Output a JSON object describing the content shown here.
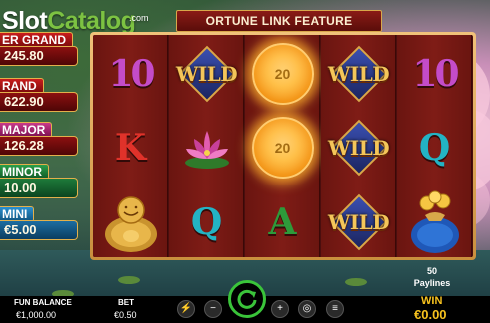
{
  "logo": {
    "slot": "Slot",
    "catalog": "Catalog",
    "com": ".com"
  },
  "banner": {
    "text": "ORTUNE LINK FEATURE"
  },
  "jackpots": [
    {
      "title": "ER GRAND",
      "value": "245.80"
    },
    {
      "title": "RAND",
      "value": "622.90"
    },
    {
      "title": "MAJOR",
      "value": "126.28"
    },
    {
      "title": "MINOR",
      "value": "10.00"
    },
    {
      "title": "MINI",
      "value": "€5.00"
    }
  ],
  "reels": {
    "col1": [
      "10",
      "K",
      "buddha"
    ],
    "col2": [
      "WILD",
      "lotus",
      "Q"
    ],
    "col3": [
      "20",
      "20",
      "A"
    ],
    "col4": [
      "WILD",
      "WILD",
      "WILD"
    ],
    "col5": [
      "10",
      "Q",
      "moneybag"
    ]
  },
  "coin_values": [
    "20",
    "20"
  ],
  "wild_label": "WILD",
  "paylines": {
    "count": "50",
    "label": "Paylines"
  },
  "balance": {
    "label": "FUN BALANCE",
    "value": "€1,000.00"
  },
  "bet": {
    "label": "BET",
    "value": "€0.50"
  },
  "win": {
    "label": "WIN",
    "value": "€0.00"
  },
  "controls": {
    "lightning_icon": "lightning-icon",
    "minus_icon": "minus-icon",
    "spin_icon": "refresh-icon",
    "plus_icon": "plus-icon",
    "coins_icon": "coin-stack-icon",
    "menu_icon": "menu-icon",
    "minus_symbol": "−",
    "plus_symbol": "+",
    "lightning_symbol": "⚡",
    "menu_symbol": "≡",
    "coins_symbol": "◎"
  },
  "colors": {
    "win_yellow": "#f7c21e",
    "spin_green": "#3ac43a",
    "banner_red": "#8a1b16"
  }
}
